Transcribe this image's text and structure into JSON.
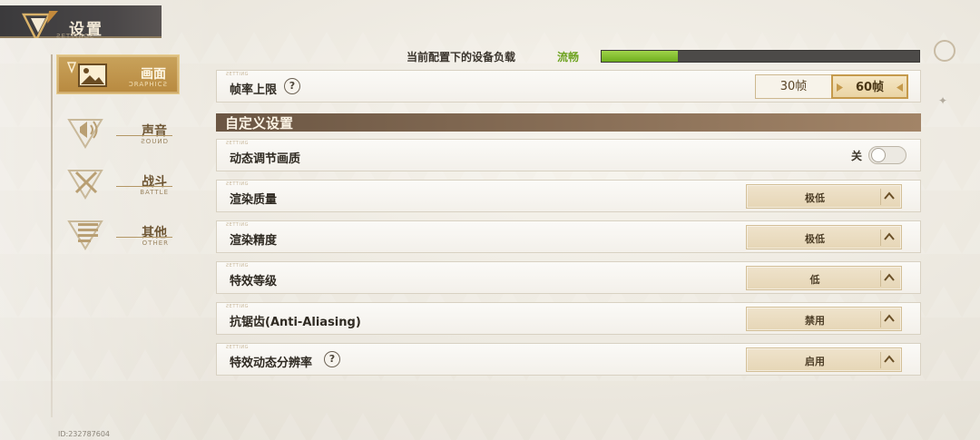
{
  "header": {
    "title": "设置",
    "subtitle": "ƧETTIИGƧ"
  },
  "sidebar": {
    "items": [
      {
        "label": "画面",
        "sub": "ƆRAPHICƧ",
        "icon": "picture-icon",
        "active": true
      },
      {
        "label": "声音",
        "sub": "ƧOUИD",
        "icon": "sound-icon",
        "active": false
      },
      {
        "label": "战斗",
        "sub": "BATTLE",
        "icon": "battle-icon",
        "active": false
      },
      {
        "label": "其他",
        "sub": "OTHER",
        "icon": "other-icon",
        "active": false
      }
    ]
  },
  "user_id": "ID:232787604",
  "load": {
    "label": "当前配置下的设备负载",
    "status": "流畅",
    "fill_fraction": 0.24
  },
  "fps": {
    "label": "帧率上限",
    "options": [
      "30帧",
      "60帧"
    ],
    "selected": "60帧"
  },
  "section": {
    "title": "自定义设置"
  },
  "settings": {
    "dynamic_quality": {
      "label": "动态调节画质",
      "state": "关",
      "on": false
    },
    "render_quality": {
      "label": "渲染质量",
      "value": "极低"
    },
    "render_precision": {
      "label": "渲染精度",
      "value": "极低"
    },
    "effect_level": {
      "label": "特效等级",
      "value": "低"
    },
    "anti_aliasing": {
      "label": "抗锯齿(Anti-Aliasing)",
      "value": "禁用"
    },
    "effect_dynamic_resolution": {
      "label": "特效动态分辨率",
      "value": "启用"
    }
  },
  "colors": {
    "accent_gold": "#c9a35c",
    "section_brown": "#7a624c",
    "load_green": "#6ea321",
    "load_bar_bg": "#4c4a48"
  }
}
